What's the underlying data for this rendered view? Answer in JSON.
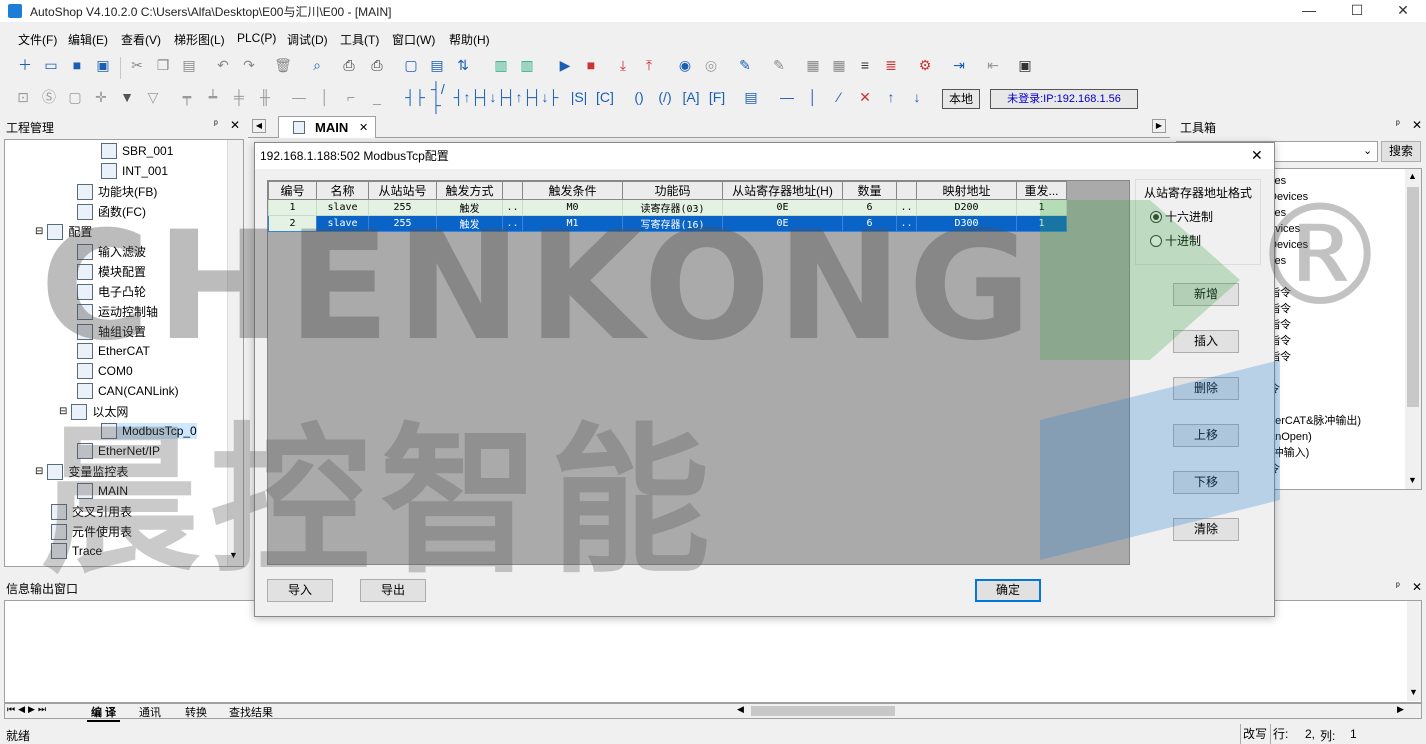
{
  "window": {
    "title": "AutoShop V4.10.2.0  C:\\Users\\Alfa\\Desktop\\E00与汇川\\E00 - [MAIN]",
    "minimize": "—",
    "maximize": "☐",
    "close": "✕"
  },
  "menu": [
    "文件(F)",
    "编辑(E)",
    "查看(V)",
    "梯形图(L)",
    "PLC(P)",
    "调试(D)",
    "工具(T)",
    "窗口(W)",
    "帮助(H)"
  ],
  "toolbar2": {
    "local_label": "本地",
    "connection_label": "未登录:IP:192.168.1.56"
  },
  "project_panel": {
    "title": "工程管理",
    "pin": "ᵖ",
    "close": "✕",
    "tree": [
      {
        "label": "SBR_001",
        "level": 3
      },
      {
        "label": "INT_001",
        "level": 3
      },
      {
        "label": "功能块(FB)",
        "level": 2
      },
      {
        "label": "函数(FC)",
        "level": 2
      },
      {
        "label": "配置",
        "level": 1
      },
      {
        "label": "输入滤波",
        "level": 2
      },
      {
        "label": "模块配置",
        "level": 2
      },
      {
        "label": "电子凸轮",
        "level": 2
      },
      {
        "label": "运动控制轴",
        "level": 2
      },
      {
        "label": "轴组设置",
        "level": 2
      },
      {
        "label": "EtherCAT",
        "level": 2
      },
      {
        "label": "COM0",
        "level": 2
      },
      {
        "label": "CAN(CANLink)",
        "level": 2
      },
      {
        "label": "以太网",
        "level": 2
      },
      {
        "label": "ModbusTcp_0",
        "level": 3
      },
      {
        "label": "EtherNet/IP",
        "level": 2
      },
      {
        "label": "变量监控表",
        "level": 1
      },
      {
        "label": "MAIN",
        "level": 2
      },
      {
        "label": "交叉引用表",
        "level": 1
      },
      {
        "label": "元件使用表",
        "level": 1
      },
      {
        "label": "Trace",
        "level": 1
      }
    ]
  },
  "editor_tab": {
    "label": "MAIN",
    "close": "✕"
  },
  "toolbox": {
    "title": "工具箱",
    "search_button": "搜索",
    "items": [
      "ces",
      "Devices",
      "ces",
      "evices",
      "Devices",
      "ces",
      "指令",
      "指令",
      "指令",
      "指令",
      "指令",
      "令",
      "herCAT&脉冲输出)",
      "anOpen)",
      "(冲输入)",
      "令"
    ]
  },
  "dialog": {
    "title": "192.168.1.188:502 ModbusTcp配置",
    "close": "✕",
    "columns": [
      "编号",
      "名称",
      "从站站号",
      "触发方式",
      "",
      "触发条件",
      "功能码",
      "从站寄存器地址(H)",
      "数量",
      "",
      "映射地址",
      "重发..."
    ],
    "rows": [
      {
        "no": "1",
        "name": "slave",
        "station": "255",
        "trigger": "触发",
        "dots": "..",
        "cond": "M0",
        "func": "读寄存器(03)",
        "addr": "0E",
        "count": "6",
        "dots2": "..",
        "map": "D200",
        "retry": "1"
      },
      {
        "no": "2",
        "name": "slave",
        "station": "255",
        "trigger": "触发",
        "dots": "..",
        "cond": "M1",
        "func": "写寄存器(16)",
        "addr": "0E",
        "count": "6",
        "dots2": "..",
        "map": "D300",
        "retry": "1"
      }
    ],
    "format_group": "从站寄存器地址格式",
    "format_hex": "十六进制",
    "format_dec": "十进制",
    "buttons": {
      "add": "新增",
      "insert": "插入",
      "delete": "删除",
      "up": "上移",
      "down": "下移",
      "clear": "清除",
      "import": "导入",
      "export": "导出",
      "ok": "确定"
    }
  },
  "info_panel": {
    "title": "信息输出窗口",
    "tabs": [
      "编 译",
      "通讯",
      "转换",
      "查找结果"
    ]
  },
  "status": {
    "ready": "就绪",
    "mode": "改写",
    "row_label": "行:",
    "row": "2,",
    "col_label": "列:",
    "col": "1"
  },
  "watermark": {
    "brand": "CHENKONG",
    "cn": "晨控智能",
    "mark": "®"
  },
  "colors": {
    "selected_row": "#0a64c8",
    "row1": "#e4f2e3",
    "accent": "#0078d7"
  }
}
